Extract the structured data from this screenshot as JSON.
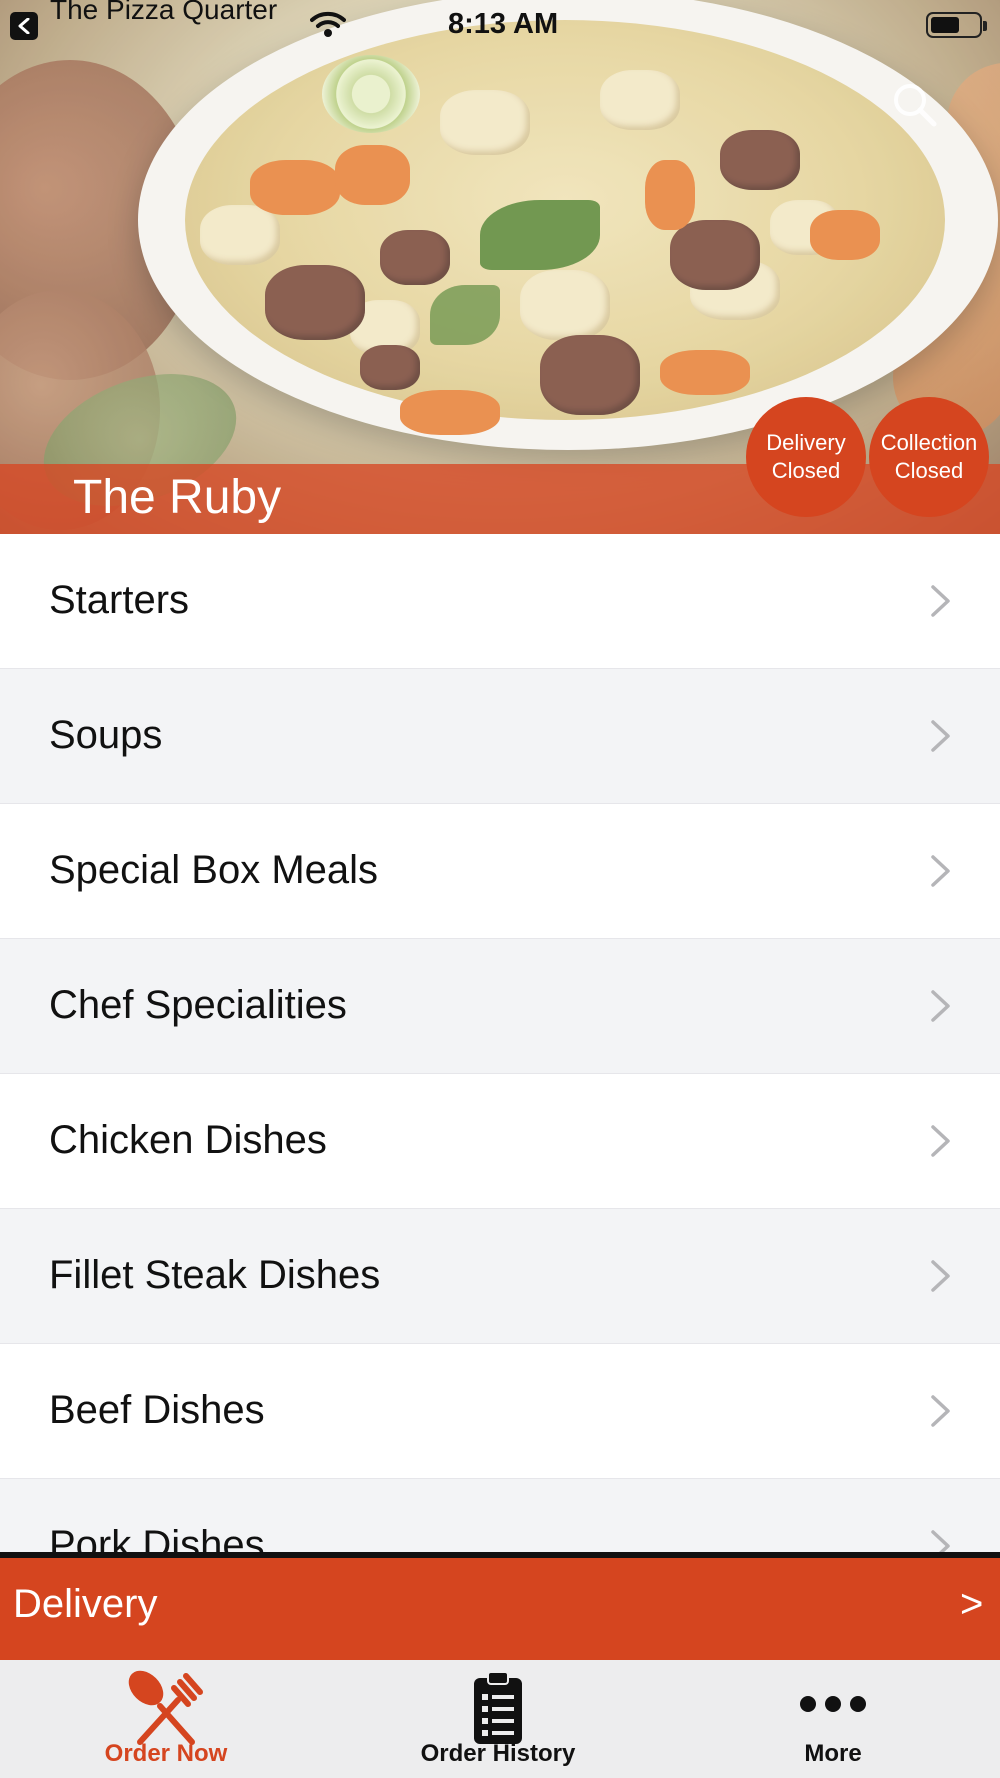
{
  "status_bar": {
    "back_app_name": "The Pizza Quarter",
    "time": "8:13 AM"
  },
  "hero": {
    "restaurant_name": "The Ruby",
    "delivery_badge": {
      "line1": "Delivery",
      "line2": "Closed"
    },
    "collection_badge": {
      "line1": "Collection",
      "line2": "Closed"
    }
  },
  "menu": {
    "categories": [
      {
        "label": "Starters"
      },
      {
        "label": "Soups"
      },
      {
        "label": "Special Box Meals"
      },
      {
        "label": "Chef Specialities"
      },
      {
        "label": "Chicken Dishes"
      },
      {
        "label": "Fillet Steak Dishes"
      },
      {
        "label": "Beef Dishes"
      },
      {
        "label": "Pork Dishes"
      }
    ]
  },
  "order_mode_bar": {
    "label": "Delivery",
    "arrow": ">"
  },
  "tab_bar": {
    "tabs": [
      {
        "label": "Order Now",
        "icon": "fork-knife-icon",
        "active": true
      },
      {
        "label": "Order History",
        "icon": "clipboard-list-icon",
        "active": false
      },
      {
        "label": "More",
        "icon": "more-dots-icon",
        "active": false
      }
    ]
  },
  "colors": {
    "accent": "#d5451f",
    "banner": "#d9573a",
    "active_tab": "#d5451f",
    "row_alt": "#f3f4f6"
  }
}
